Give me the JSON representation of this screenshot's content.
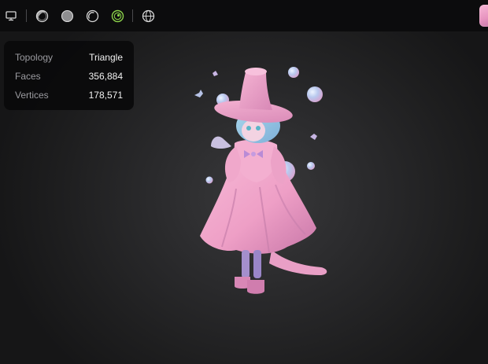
{
  "toolbar": {
    "buttons": [
      {
        "name": "display-button",
        "icon": "monitor-icon"
      },
      {
        "name": "matcap-shading-button",
        "icon": "half-sphere-icon"
      },
      {
        "name": "solid-shading-button",
        "icon": "gray-sphere-icon"
      },
      {
        "name": "outline-shading-button",
        "icon": "outline-sphere-icon"
      },
      {
        "name": "normal-shading-button",
        "icon": "green-sphere-icon",
        "active": true
      },
      {
        "name": "wireframe-button",
        "icon": "globe-wire-icon"
      }
    ],
    "active_color": "#8bd14a"
  },
  "stats": {
    "topology_label": "Topology",
    "topology_value": "Triangle",
    "faces_label": "Faces",
    "faces_value": "356,884",
    "vertices_label": "Vertices",
    "vertices_value": "178,571"
  },
  "scene": {
    "model": "witch-character-model",
    "model_color": "#f2a6c8",
    "hair_color": "#8fc6e0"
  }
}
